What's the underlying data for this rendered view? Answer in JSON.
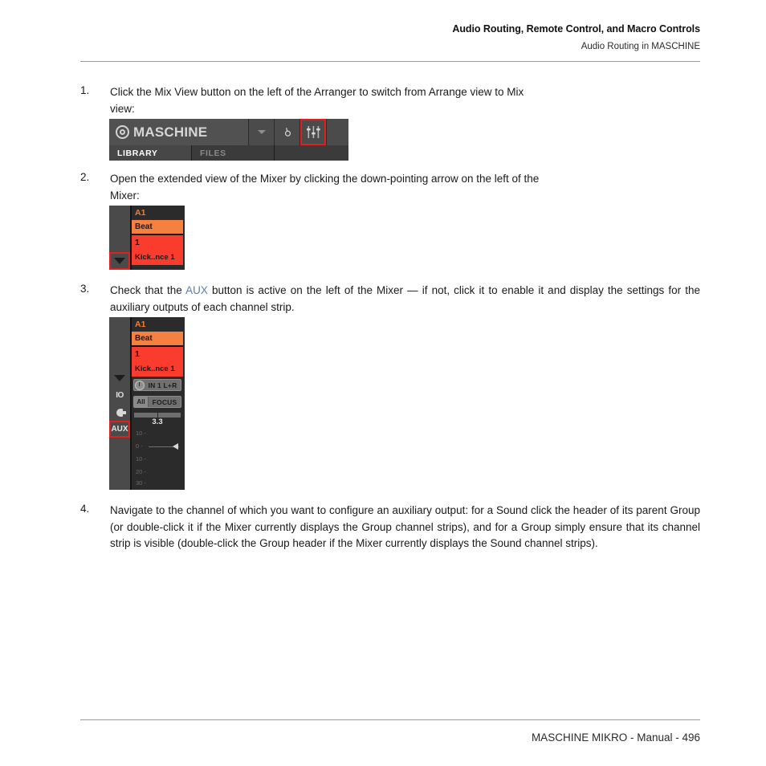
{
  "header": {
    "title": "Audio Routing, Remote Control, and Macro Controls",
    "subtitle": "Audio Routing in MASCHINE"
  },
  "footer": {
    "text": "MASCHINE MIKRO - Manual - 496"
  },
  "steps": [
    {
      "number": "1.",
      "line1": "Click the Mix View button on the left of the Arranger to switch from Arrange view to Mix",
      "line2": "view:"
    },
    {
      "number": "2.",
      "line1": "Open the extended view of the Mixer by clicking the down-pointing arrow on the left of the",
      "line2": "Mixer:"
    },
    {
      "number": "3.",
      "text_before": "Check that the ",
      "link": "AUX",
      "text_after": " button is active on the left of the Mixer — if not, click it to enable it and display the settings for the auxiliary outputs of each channel strip."
    },
    {
      "number": "4.",
      "text": "Navigate to the channel of which you want to configure an auxiliary output: for a Sound click the header of its parent Group (or double-click it if the Mixer currently displays the Group channel strips), and for a Group simply ensure that its channel strip is visible (double-click the Group header if the Mixer currently displays the Sound channel strips)."
    }
  ],
  "toolbar_shot": {
    "logo_text": "MASCHINE",
    "logo_icon": "concentric-circle-icon",
    "dropdown_icon": "chevron-down-icon",
    "search_icon": "magnifier-icon",
    "mix_view_icon": "mixer-sliders-icon",
    "tabs": [
      {
        "label": "LIBRARY",
        "active": true
      },
      {
        "label": "FILES",
        "active": false
      }
    ]
  },
  "mixer_shot_small": {
    "arrow_icon": "triangle-down-icon",
    "group_label": "A1",
    "group_name": "Beat",
    "sound_number": "1",
    "sound_name": "Kick..nce 1"
  },
  "mixer_shot_large": {
    "arrow_icon": "triangle-down-icon",
    "group_label": "A1",
    "group_name": "Beat",
    "sound_number": "1",
    "sound_name": "Kick..nce 1",
    "left_buttons": [
      {
        "label": "IO",
        "icon": "io-icon"
      },
      {
        "label": "",
        "icon": "plug-icon"
      },
      {
        "label": "AUX",
        "icon": "aux-button",
        "highlighted": true
      }
    ],
    "input_row": {
      "knob_icon": "knob-icon",
      "label": "IN 1 L+R"
    },
    "focus_row": {
      "sub_label": "All",
      "label": "FOCUS"
    },
    "fader": {
      "value": "3.3",
      "scale": [
        "10 -",
        "0 -",
        "10 -",
        "20 -",
        "30 -"
      ]
    }
  },
  "colors": {
    "link": "#5b7fa6",
    "highlight_box": "#e02020",
    "group_orange": "#f5803f",
    "sound_red": "#fa3c2e"
  }
}
